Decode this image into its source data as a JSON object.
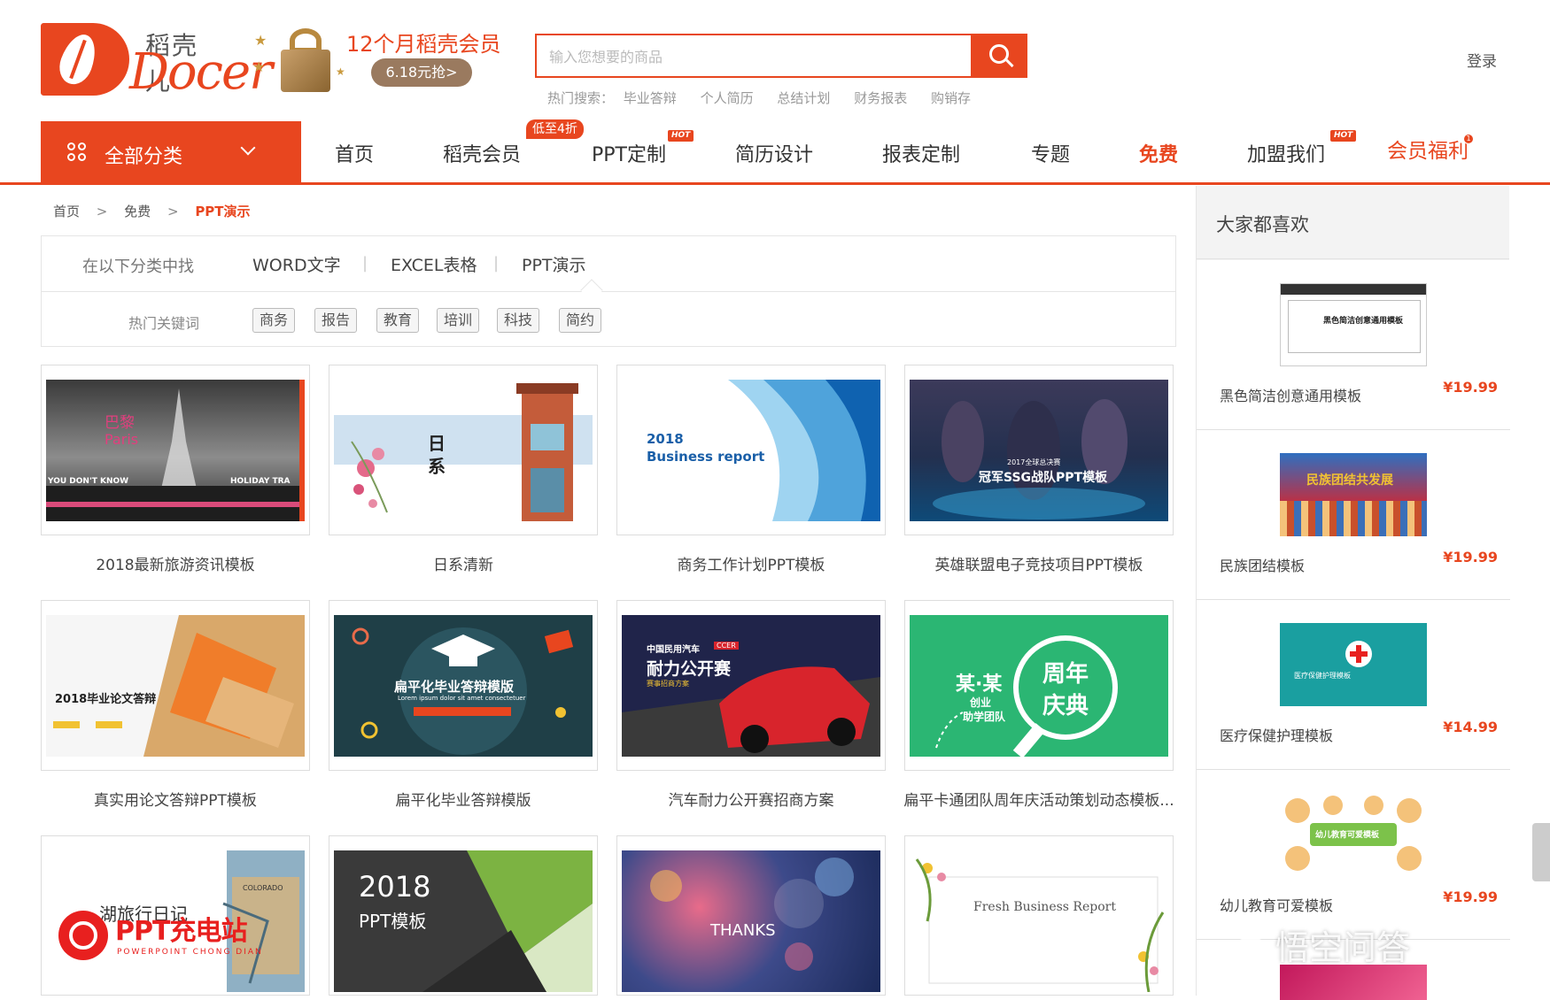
{
  "logo": {
    "cn": "稻壳儿",
    "en": "Docer"
  },
  "promo": {
    "title": "12个月稻壳会员",
    "cta": "6.18元抢>"
  },
  "search": {
    "placeholder": "输入您想要的商品"
  },
  "hot_search": {
    "label": "热门搜索：",
    "terms": [
      "毕业答辩",
      "个人简历",
      "总结计划",
      "财务报表",
      "购销存"
    ]
  },
  "login_label": "登录",
  "nav": {
    "all_categories": "全部分类",
    "items": [
      "首页",
      "稻壳会员",
      "PPT定制",
      "简历设计",
      "报表定制",
      "专题",
      "免费",
      "加盟我们",
      "会员福利"
    ],
    "discount_badge": "低至4折",
    "hot_badge": "HOT",
    "welfare_badge": "1"
  },
  "breadcrumb": {
    "items": [
      "首页",
      "免费",
      "PPT演示"
    ],
    "separator": ">"
  },
  "filter": {
    "label": "在以下分类中找",
    "categories": [
      "WORD文字",
      "EXCEL表格",
      "PPT演示"
    ],
    "keywords_label": "热门关键词",
    "keywords": [
      "商务",
      "报告",
      "教育",
      "培训",
      "科技",
      "简约"
    ]
  },
  "products": [
    {
      "title": "2018最新旅游资讯模板",
      "thumb_text": [
        "巴黎",
        "Paris",
        "YOU DON'T KNOW",
        "HOLIDAY TRA"
      ]
    },
    {
      "title": "日系清新",
      "thumb_text": [
        "日",
        "系"
      ]
    },
    {
      "title": "商务工作计划PPT模板",
      "thumb_text": [
        "2018",
        "Business report"
      ]
    },
    {
      "title": "英雄联盟电子竞技项目PPT模板",
      "thumb_text": [
        "2017全球总决赛",
        "冠军SSG战队PPT模板"
      ]
    },
    {
      "title": "真实用论文答辩PPT模板",
      "thumb_text": [
        "2018毕业论文答辩"
      ]
    },
    {
      "title": "扁平化毕业答辩模版",
      "thumb_text": [
        "扁平化毕业答辩模版",
        "Lorem ipsum dolor sit amet consectetuer"
      ]
    },
    {
      "title": "汽车耐力公开赛招商方案",
      "thumb_text": [
        "中国民用汽车",
        "CCER",
        "耐力公开赛",
        "赛事招商方案"
      ]
    },
    {
      "title": "扁平卡通团队周年庆活动策划动态模板...",
      "thumb_text": [
        "某·某",
        "创业",
        "助学团队",
        "周年",
        "庆典"
      ]
    },
    {
      "title": "",
      "thumb_text": [
        "湖旅行日记",
        "COLORADO",
        "PPT充电站",
        "POWERPOINT CHONG DIAN"
      ]
    },
    {
      "title": "",
      "thumb_text": [
        "2018",
        "PPT模板"
      ]
    },
    {
      "title": "",
      "thumb_text": [
        "THANKS"
      ]
    },
    {
      "title": "",
      "thumb_text": [
        "Fresh Business Report"
      ]
    }
  ],
  "sidebar": {
    "title": "大家都喜欢",
    "items": [
      {
        "name": "黑色简洁创意通用模板",
        "price": "¥19.99",
        "thumb_text": "黑色简洁创意通用模板"
      },
      {
        "name": "民族团结模板",
        "price": "¥19.99",
        "thumb_text": "民族团结共发展"
      },
      {
        "name": "医疗保健护理模板",
        "price": "¥14.99",
        "thumb_text": "医疗保健护理模板"
      },
      {
        "name": "幼儿教育可爱模板",
        "price": "¥19.99",
        "thumb_text": "幼儿教育可爱模板"
      },
      {
        "name": "",
        "price": "",
        "thumb_text": ""
      }
    ]
  },
  "watermark": "悟空问答",
  "colors": {
    "brand": "#e8461f",
    "sidebar_bg": "#f3f3f3"
  }
}
